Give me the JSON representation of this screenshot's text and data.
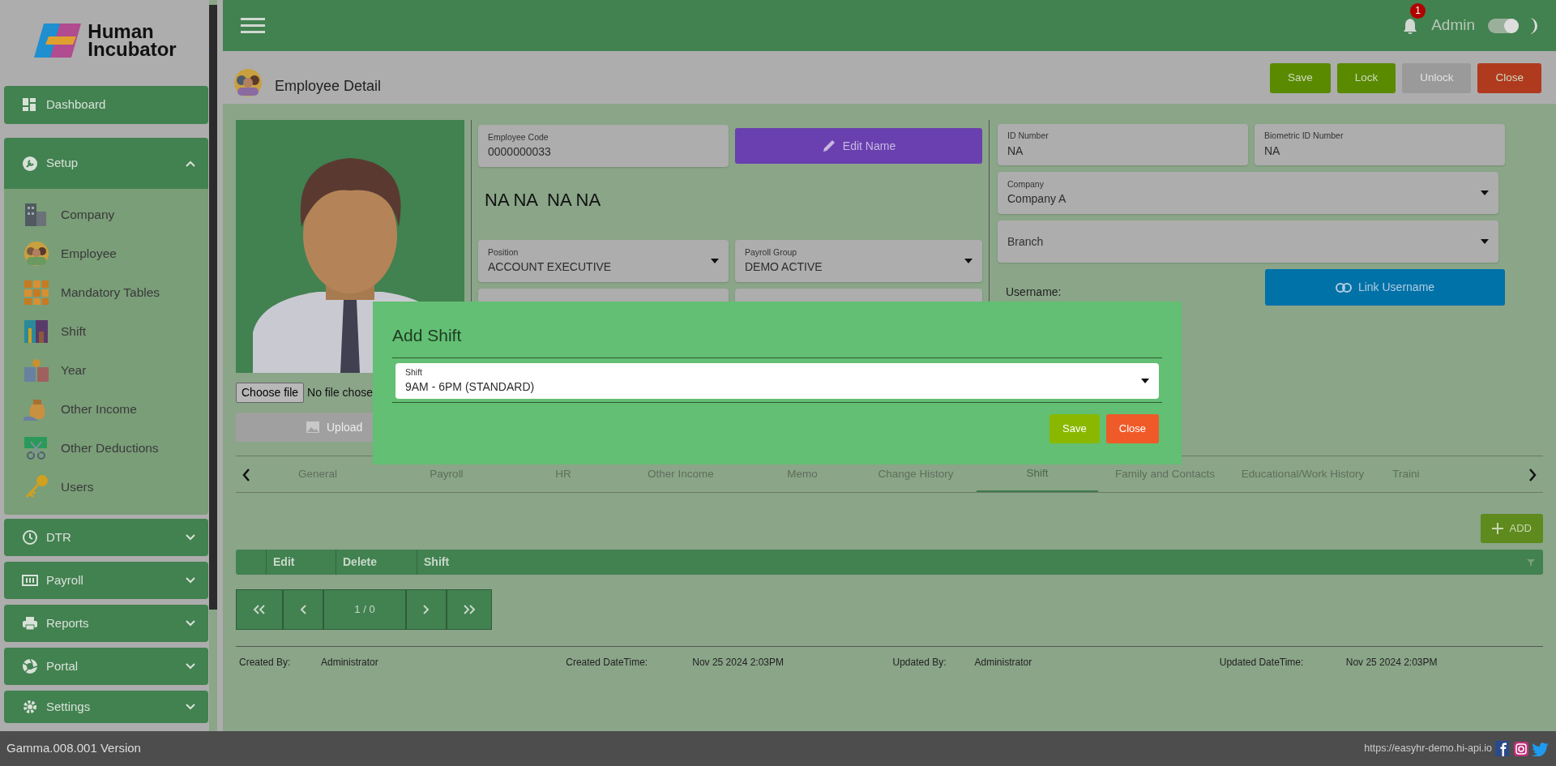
{
  "brand": {
    "line1": "Human",
    "line2": "Incubator"
  },
  "sidebar": {
    "items": [
      {
        "label": "Dashboard",
        "kind": "link"
      },
      {
        "label": "Setup",
        "kind": "group",
        "expanded": true,
        "children": [
          {
            "label": "Company"
          },
          {
            "label": "Employee"
          },
          {
            "label": "Mandatory Tables"
          },
          {
            "label": "Shift"
          },
          {
            "label": "Year"
          },
          {
            "label": "Other Income"
          },
          {
            "label": "Other Deductions"
          },
          {
            "label": "Users"
          }
        ]
      },
      {
        "label": "DTR",
        "kind": "group",
        "expanded": false
      },
      {
        "label": "Payroll",
        "kind": "group",
        "expanded": false
      },
      {
        "label": "Reports",
        "kind": "group",
        "expanded": false
      },
      {
        "label": "Portal",
        "kind": "group",
        "expanded": false
      },
      {
        "label": "Settings",
        "kind": "group",
        "expanded": false
      }
    ]
  },
  "header": {
    "notification_count": "1",
    "user": "Admin",
    "dark_mode": true
  },
  "page": {
    "title": "Employee Detail",
    "actions": [
      {
        "label": "Save",
        "kind": "save",
        "disabled": false
      },
      {
        "label": "Lock",
        "kind": "lock",
        "disabled": false
      },
      {
        "label": "Unlock",
        "kind": "unlock",
        "disabled": true
      },
      {
        "label": "Close",
        "kind": "close",
        "disabled": false
      }
    ]
  },
  "photo": {
    "file_button": "Choose file",
    "file_status": "No file chose",
    "upload_button": "Upload"
  },
  "details": {
    "employee_code": {
      "label": "Employee Code",
      "value": "0000000033"
    },
    "edit_name_button": "Edit Name",
    "full_name": "NA NA  NA NA",
    "position": {
      "label": "Position",
      "value": "ACCOUNT EXECUTIVE"
    },
    "payroll_group": {
      "label": "Payroll Group",
      "value": "DEMO ACTIVE"
    },
    "id_number": {
      "label": "ID Number",
      "value": "NA"
    },
    "biometric_id": {
      "label": "Biometric ID Number",
      "value": "NA"
    },
    "company": {
      "label": "Company",
      "value": "Company A"
    },
    "branch": {
      "placeholder": "Branch"
    },
    "username_label": "Username:",
    "link_username_button": "Link Username"
  },
  "modal": {
    "title": "Add Shift",
    "shift": {
      "label": "Shift",
      "value": "9AM - 6PM (STANDARD)"
    },
    "buttons": [
      {
        "label": "Save",
        "kind": "save"
      },
      {
        "label": "Close",
        "kind": "close"
      }
    ]
  },
  "tabs": [
    {
      "label": "General",
      "selected": false
    },
    {
      "label": "Payroll",
      "selected": false
    },
    {
      "label": "HR",
      "selected": false
    },
    {
      "label": "Other Income",
      "selected": false
    },
    {
      "label": "Memo",
      "selected": false
    },
    {
      "label": "Change History",
      "selected": false
    },
    {
      "label": "Shift",
      "selected": true
    },
    {
      "label": "Family and Contacts",
      "selected": false
    },
    {
      "label": "Educational/Work History",
      "selected": false
    },
    {
      "label": "Traini",
      "selected": false
    }
  ],
  "add_button": "ADD",
  "table": {
    "columns": [
      "Edit",
      "Delete",
      "Shift"
    ]
  },
  "pager": {
    "page": "1 / 0"
  },
  "audit": [
    {
      "label": "Created By:",
      "value": "Administrator"
    },
    {
      "label": "Created DateTime:",
      "value": "Nov 25 2024 2:03PM"
    },
    {
      "label": "Updated By:",
      "value": "Administrator"
    },
    {
      "label": "Updated DateTime:",
      "value": "Nov 25 2024 2:03PM"
    }
  ],
  "footer": {
    "version": "Gamma.008.001 Version",
    "url": "https://easyhr-demo.hi-api.io"
  }
}
